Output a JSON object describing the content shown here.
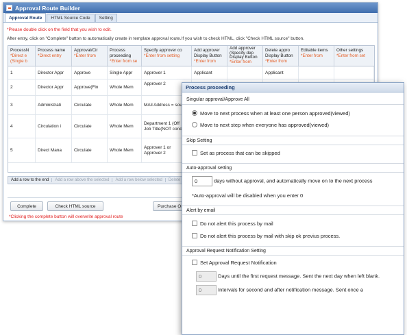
{
  "window": {
    "title": "Approval Route Builder",
    "tabs": [
      "Approval Route",
      "HTML Source Code",
      "Setting"
    ]
  },
  "notes": {
    "instruction_red": "*Please double click on the field that you wish to edit.",
    "instruction": "After entry, click on \"Complete\" button to automatically create in template approval route.If you wish to check HTML, click \"Check HTML source\" button.",
    "footer": "*Clicking the complete button will overwrite approval route"
  },
  "grid": {
    "columns": [
      {
        "label": "ProcessN",
        "hint": "*Direct e",
        "hint2": "(Single b"
      },
      {
        "label": "Process name",
        "hint": "*Direct entry",
        "hint2": ""
      },
      {
        "label": "Approval/Cir",
        "hint": "*Enter from",
        "hint2": ""
      },
      {
        "label": "Process",
        "label2": "proceeding",
        "hint": "*Enter from se",
        "hint2": ""
      },
      {
        "label": "Specify approver co",
        "hint": "*Enter from setting",
        "hint2": ""
      },
      {
        "label": "Add approver",
        "label2": "Display Button",
        "hint": "*Enter from",
        "hint2": ""
      },
      {
        "label": "Add approver",
        "label2": "(Specify dep",
        "label3": "Display Button",
        "hint": "*Enter from",
        "hint2": ""
      },
      {
        "label": "Delete appro",
        "label2": "Display Button",
        "hint": "*Enter from",
        "hint2": ""
      },
      {
        "label": "Editable items",
        "hint": "*Enter from",
        "hint2": ""
      },
      {
        "label": "Other settings",
        "hint": "*Enter from set",
        "hint2": ""
      }
    ],
    "rows": [
      {
        "no": "1",
        "name": "Director Appr",
        "type": "Approve",
        "proc": "Single Appr",
        "spec": "Approver 1",
        "spec2": "",
        "add": "Applicant",
        "delete": "Applicant"
      },
      {
        "no": "2",
        "name": "Director Appr",
        "type": "Approve(Fin",
        "proc": "Whole Mem",
        "spec": "Approver 2",
        "spec2": "",
        "add": "",
        "delete": ""
      },
      {
        "no": "3",
        "name": "Administrati",
        "type": "Circulate",
        "proc": "Whole Mem",
        "spec": "MAil Address = sou",
        "spec2": "",
        "add": "",
        "delete": ""
      },
      {
        "no": "4",
        "name": "Circulation i",
        "type": "Circulate",
        "proc": "Whole Mem",
        "spec": "Department 1 (Off",
        "spec2": "Job Title(NOT conc",
        "add": "",
        "delete": ""
      },
      {
        "no": "5",
        "name": "Direct Mana",
        "type": "Circulate",
        "proc": "Whole Mem",
        "spec": "Approver 1 or",
        "spec2": "Approver 2",
        "add": "",
        "delete": ""
      }
    ],
    "toolbar": [
      "Add a row to the end",
      "Add a row above the selected",
      "Add a row below selected",
      "Delete a"
    ]
  },
  "buttons": {
    "complete": "Complete",
    "check_html": "Check HTML source",
    "purchase": "Purchase Ord"
  },
  "dialog": {
    "title": "Process proceeding",
    "singular": {
      "heading": "Singular approval/Approve All",
      "options": [
        {
          "label": "Move to next process when at least one person approved(viewed)",
          "selected": true
        },
        {
          "label": "Move to next step when everyone has approved(viewed)",
          "selected": false
        }
      ]
    },
    "skip": {
      "heading": "Skip Setting",
      "label": "Set as process that can be skipped"
    },
    "auto": {
      "heading": "Auto-approval setting",
      "days_value": "0",
      "text": "days without approval, and automatically move on to the next process",
      "note": "*Auto-approval will be disabled when you enter 0"
    },
    "alert": {
      "heading": "Alert by email",
      "options": [
        "Do not alert this process by mail",
        "Do not alert this process by mail with skip ok previus process."
      ]
    },
    "notify": {
      "heading": "Approval Request Notification Setting",
      "set_label": "Set Approval Request Notification",
      "first_value": "0",
      "first_text": "Days until the first request message. Sent the next day when left blank.",
      "interval_value": "0",
      "interval_text": "Intervals for second and after notification message. Sent once a"
    }
  }
}
